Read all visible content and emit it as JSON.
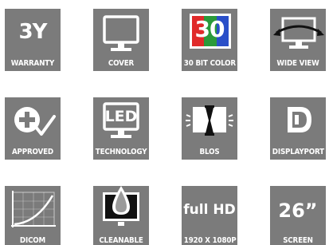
{
  "tiles": {
    "warranty": {
      "headline": "3Y",
      "label": "WARRANTY",
      "icon": "3y-text"
    },
    "cover": {
      "label": "COVER",
      "icon": "monitor-outline-icon"
    },
    "color": {
      "headline": "30",
      "label": "30 BIT COLOR",
      "icon": "rgb-30-icon"
    },
    "wide_view": {
      "label": "WIDE VIEW",
      "icon": "wide-view-arrow-icon"
    },
    "approved": {
      "label": "APPROVED",
      "icon": "cross-check-icon"
    },
    "technology": {
      "headline": "LED",
      "label": "TECHNOLOGY",
      "icon": "led-monitor-icon"
    },
    "blos": {
      "label": "BLOS",
      "icon": "hourglass-monitor-icon"
    },
    "displayport": {
      "label": "DISPLAYPORT",
      "icon": "displayport-logo-icon"
    },
    "dicom": {
      "label": "DICOM",
      "icon": "dicom-curve-icon"
    },
    "cleanable": {
      "label": "CLEANABLE",
      "icon": "droplet-monitor-icon"
    },
    "fullhd": {
      "headline": "full HD",
      "label": "1920 X 1080P",
      "icon": "full-hd-text"
    },
    "screen": {
      "headline": "26”",
      "label": "SCREEN",
      "icon": "screen-size-text"
    }
  },
  "colors": {
    "tile_bg": "#7b7b7b",
    "icon_white": "#ffffff",
    "red": "#e02a2a",
    "green": "#2a9a3a",
    "blue": "#2a4fc8"
  }
}
